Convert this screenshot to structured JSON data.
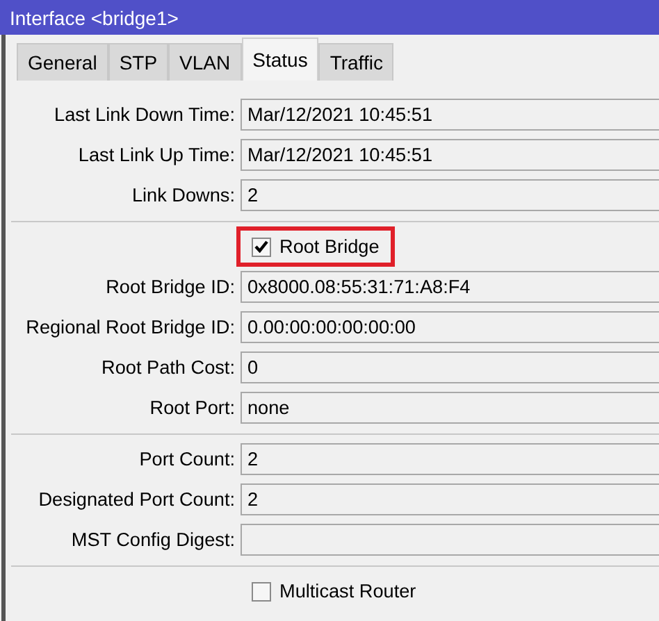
{
  "window": {
    "title": "Interface <bridge1>"
  },
  "tabs": [
    {
      "label": "General",
      "selected": false
    },
    {
      "label": "STP",
      "selected": false
    },
    {
      "label": "VLAN",
      "selected": false
    },
    {
      "label": "Status",
      "selected": true
    },
    {
      "label": "Traffic",
      "selected": false
    }
  ],
  "groups": [
    {
      "rows": [
        {
          "kind": "field",
          "label": "Last Link Down Time:",
          "value": "Mar/12/2021 10:45:51"
        },
        {
          "kind": "field",
          "label": "Last Link Up Time:",
          "value": "Mar/12/2021 10:45:51"
        },
        {
          "kind": "field",
          "label": "Link Downs:",
          "value": "2"
        }
      ]
    },
    {
      "rows": [
        {
          "kind": "checkbox",
          "label": "Root Bridge",
          "checked": true,
          "highlighted": true
        },
        {
          "kind": "field",
          "label": "Root Bridge ID:",
          "value": "0x8000.08:55:31:71:A8:F4"
        },
        {
          "kind": "field",
          "label": "Regional Root Bridge ID:",
          "value": "0.00:00:00:00:00:00"
        },
        {
          "kind": "field",
          "label": "Root Path Cost:",
          "value": "0"
        },
        {
          "kind": "field",
          "label": "Root Port:",
          "value": "none"
        }
      ]
    },
    {
      "rows": [
        {
          "kind": "field",
          "label": "Port Count:",
          "value": "2"
        },
        {
          "kind": "field",
          "label": "Designated Port Count:",
          "value": "2"
        },
        {
          "kind": "field",
          "label": "MST Config Digest:"
        }
      ]
    },
    {
      "rows": [
        {
          "kind": "checkbox",
          "label": "Multicast Router",
          "checked": false,
          "highlighted": false
        }
      ]
    }
  ]
}
